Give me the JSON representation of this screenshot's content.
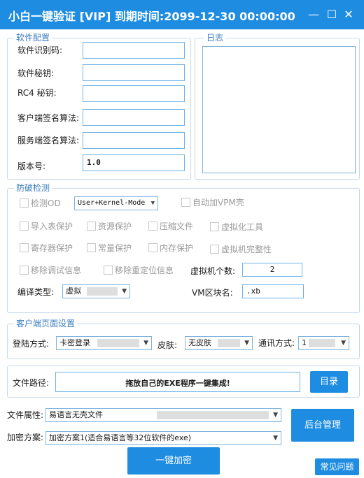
{
  "window": {
    "title": "小白一键验证 [VIP]  到期时间:2099-12-30 00:00:00",
    "minimize": "—",
    "maximize": "☐",
    "close": "✕"
  },
  "software_config": {
    "legend": "软件配置",
    "fields": [
      {
        "label": "软件识别码:",
        "value": ""
      },
      {
        "label": "软件秘钥:",
        "value": ""
      },
      {
        "label": "RC4 秘钥:",
        "value": ""
      },
      {
        "label": "客户端签名算法:",
        "value": ""
      },
      {
        "label": "服务端签名算法:",
        "value": ""
      },
      {
        "label": "版本号:",
        "value": "1.0"
      }
    ]
  },
  "log": {
    "legend": "日志"
  },
  "protection": {
    "legend": "防破检测",
    "detect_od": "检测OD",
    "mode_select": "User+Kernel-Mode",
    "auto_vmp": "自动加VPM壳",
    "import_protect": "导入表保护",
    "resource_protect": "资源保护",
    "compress_file": "压缩文件",
    "virtual_tool": "虚拟化工具",
    "register_protect": "寄存器保护",
    "constant_protect": "常量保护",
    "memory_protect": "内存保护",
    "vm_integrity": "虚拟机完整性",
    "remove_debug": "移除调试信息",
    "remove_reloc": "移除重定位信息",
    "vm_count_label": "虚拟机个数:",
    "vm_count_value": "2",
    "compile_type_label": "编译类型:",
    "compile_type_value": "虚拟",
    "vm_section_label": "VM区块名:",
    "vm_section_value": ".xb"
  },
  "client_page": {
    "legend": "客户端页面设置",
    "login_label": "登陆方式:",
    "login_value": "卡密登录",
    "skin_label": "皮肤:",
    "skin_value": "无皮肤",
    "comm_label": "通讯方式:",
    "comm_value": "1"
  },
  "file_path": {
    "label": "文件路径:",
    "value": "拖放自己的EXE程序一键集成!",
    "dir_button": "目录"
  },
  "bottom": {
    "file_attr_label": "文件属性:",
    "file_attr_value": "易语言无壳文件",
    "encrypt_label": "加密方案:",
    "encrypt_value": "加密方案1(适合易语言等32位软件的exe)",
    "backend_button": "后台管理",
    "encrypt_button": "一键加密",
    "faq_button": "常见问题"
  }
}
